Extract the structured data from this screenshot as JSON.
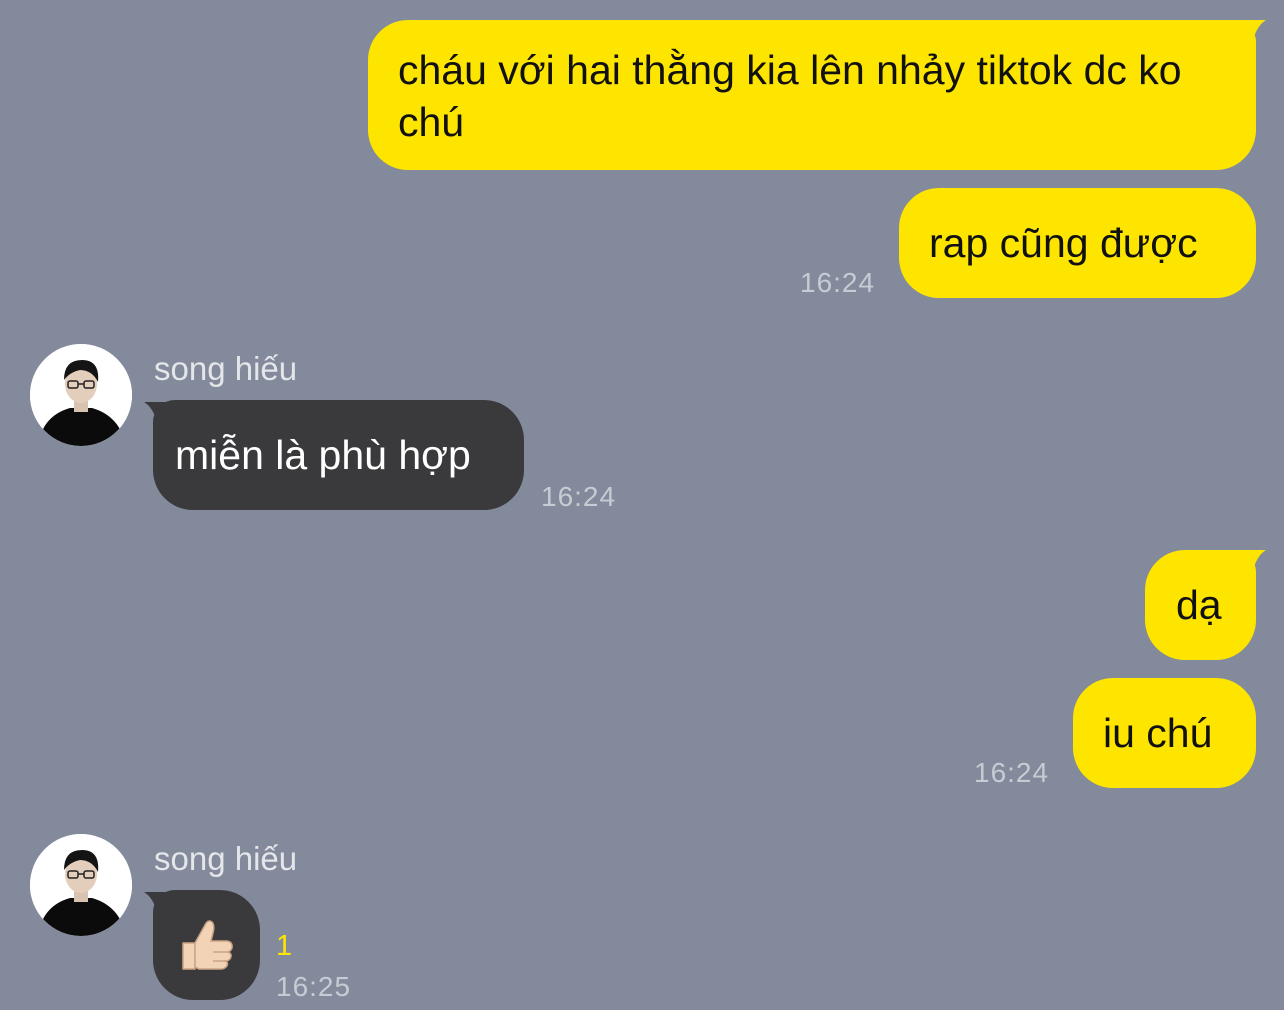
{
  "messages": [
    {
      "direction": "out",
      "text": "cháu với hai thằng kia lên nhảy tiktok dc ko chú"
    },
    {
      "direction": "out",
      "text": "rap cũng được",
      "time": "16:24"
    },
    {
      "direction": "in",
      "sender": "song hiếu",
      "text": "miễn là phù hợp",
      "time": "16:24"
    },
    {
      "direction": "out",
      "text": "dạ"
    },
    {
      "direction": "out",
      "text": "iu chú",
      "time": "16:24"
    },
    {
      "direction": "in",
      "sender": "song hiếu",
      "sticker": "thumbs-up-emoji",
      "glyph": "👍🏻",
      "unread": "1",
      "time": "16:25"
    }
  ],
  "colors": {
    "background": "#838a9b",
    "outgoing_bubble": "#fee500",
    "incoming_bubble": "#3a3a3c",
    "unread_count": "#fee500"
  }
}
